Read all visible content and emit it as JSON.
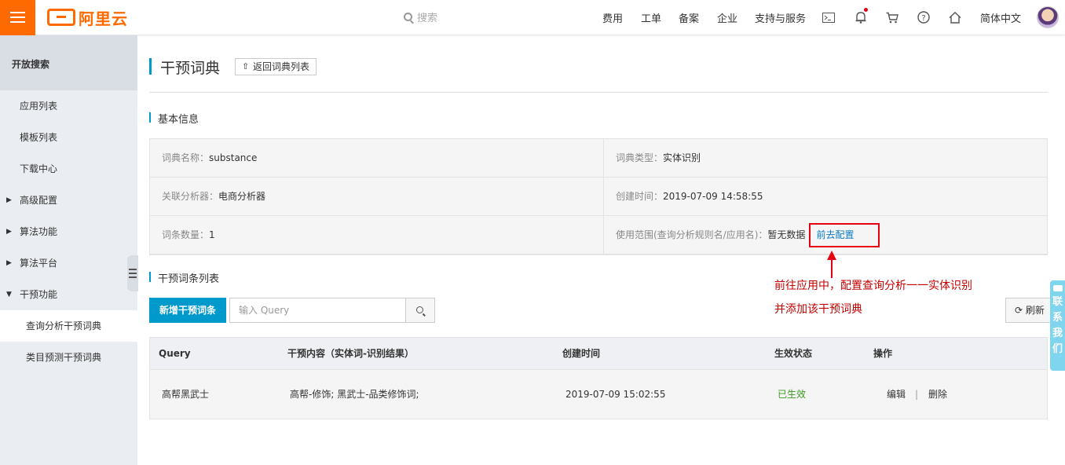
{
  "brand": {
    "name": "阿里云",
    "accent": "#ff6a00"
  },
  "header": {
    "search_placeholder": "搜索",
    "nav": [
      "费用",
      "工单",
      "备案",
      "企业",
      "支持与服务"
    ],
    "icons": [
      "terminal-icon",
      "bell-icon",
      "cart-icon",
      "help-icon",
      "home-icon"
    ],
    "language": "简体中文"
  },
  "sidebar": {
    "title": "开放搜索",
    "items": [
      {
        "label": "应用列表"
      },
      {
        "label": "模板列表"
      },
      {
        "label": "下载中心"
      },
      {
        "label": "高级配置"
      },
      {
        "label": "算法功能"
      },
      {
        "label": "算法平台"
      },
      {
        "label": "干预功能"
      },
      {
        "label": "查询分析干预词典"
      },
      {
        "label": "类目预测干预词典"
      }
    ]
  },
  "page": {
    "title": "干预词典",
    "back_label": "返回词典列表",
    "basic_section": "基本信息",
    "info": {
      "name_key": "词典名称：",
      "name_val": "substance",
      "type_key": "词典类型：",
      "type_val": "实体识别",
      "analyzer_key": "关联分析器：",
      "analyzer_val": "电商分析器",
      "created_key": "创建时间：",
      "created_val": "2019-07-09 14:58:55",
      "count_key": "词条数量：",
      "count_val": "1",
      "scope_key": "使用范围(查询分析规则名/应用名)：",
      "scope_val": "暂无数据",
      "config_link": "前去配置"
    },
    "annotation": {
      "line1": "前往应用中，配置查询分析一一实体识别",
      "line2": "并添加该干预词典"
    },
    "list_section": "干预词条列表",
    "add_button": "新增干预词条",
    "query_placeholder": "输入 Query",
    "refresh_label": "刷新",
    "table": {
      "headers": [
        "Query",
        "干预内容（实体词-识别结果）",
        "创建时间",
        "生效状态",
        "操作"
      ],
      "rows": [
        {
          "query": "高帮黑武士",
          "content": "高帮-修饰; 黑武士-品类修饰词;",
          "created": "2019-07-09 15:02:55",
          "status": "已生效",
          "edit": "编辑",
          "sep": "|",
          "delete": "删除"
        }
      ]
    }
  },
  "contact": {
    "label": "联系我们"
  }
}
